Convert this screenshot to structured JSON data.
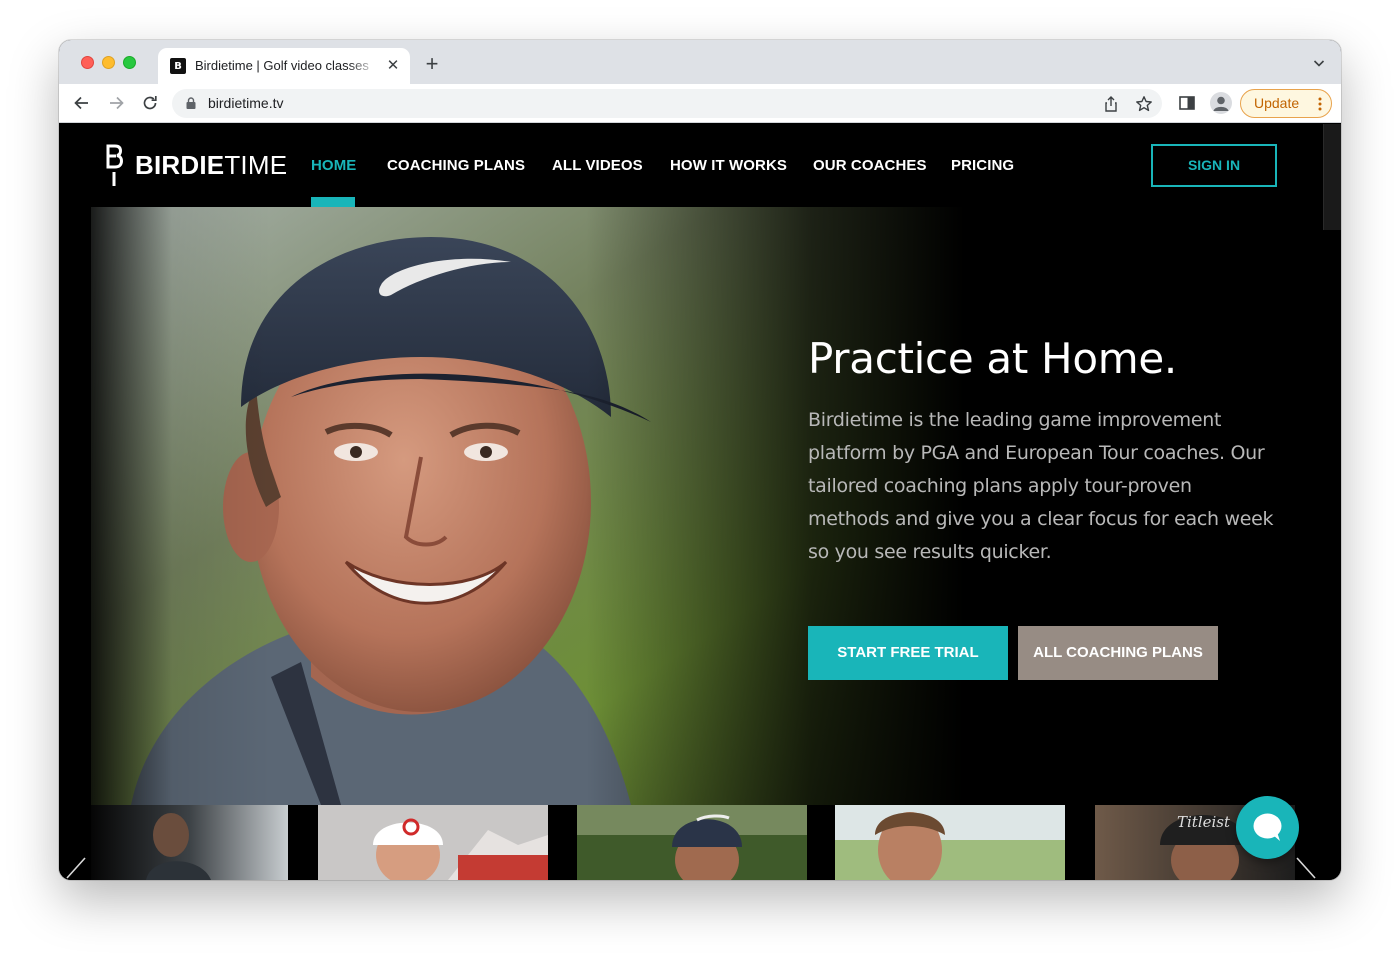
{
  "browser": {
    "tab_title": "Birdietime | Golf video classes",
    "tab_favicon_letter": "B",
    "url": "birdietime.tv",
    "update_label": "Update"
  },
  "site": {
    "logo_letter": "B",
    "logo_bold": "BIRDIE",
    "logo_light": "TIME",
    "nav": [
      {
        "label": "HOME",
        "active": true
      },
      {
        "label": "COACHING PLANS"
      },
      {
        "label": "ALL VIDEOS"
      },
      {
        "label": "HOW IT WORKS"
      },
      {
        "label": "OUR COACHES"
      },
      {
        "label": "PRICING"
      }
    ],
    "sign_in": "SIGN IN"
  },
  "hero": {
    "title": "Practice at Home.",
    "body": "Birdietime is the leading game improvement platform by PGA and European Tour coaches. Our tailored coaching plans apply tour-proven methods and give you a clear focus for each week so you see results quicker.",
    "primary_cta": "START FREE TRIAL",
    "secondary_cta": "ALL COACHING PLANS"
  },
  "carousel": {
    "thumbnail_count": 5,
    "thumb_brand_text": "Titleist"
  },
  "colors": {
    "accent": "#19b5b9",
    "secondary_button": "#978c84",
    "page_background": "#000000"
  },
  "icons": [
    "back-arrow-icon",
    "forward-arrow-icon",
    "reload-icon",
    "lock-icon",
    "share-icon",
    "star-icon",
    "sidepanel-icon",
    "profile-icon",
    "kebab-menu-icon",
    "tab-close-icon",
    "new-tab-icon",
    "chevron-down-icon",
    "chat-bubble-icon",
    "carousel-prev-icon",
    "carousel-next-icon"
  ]
}
